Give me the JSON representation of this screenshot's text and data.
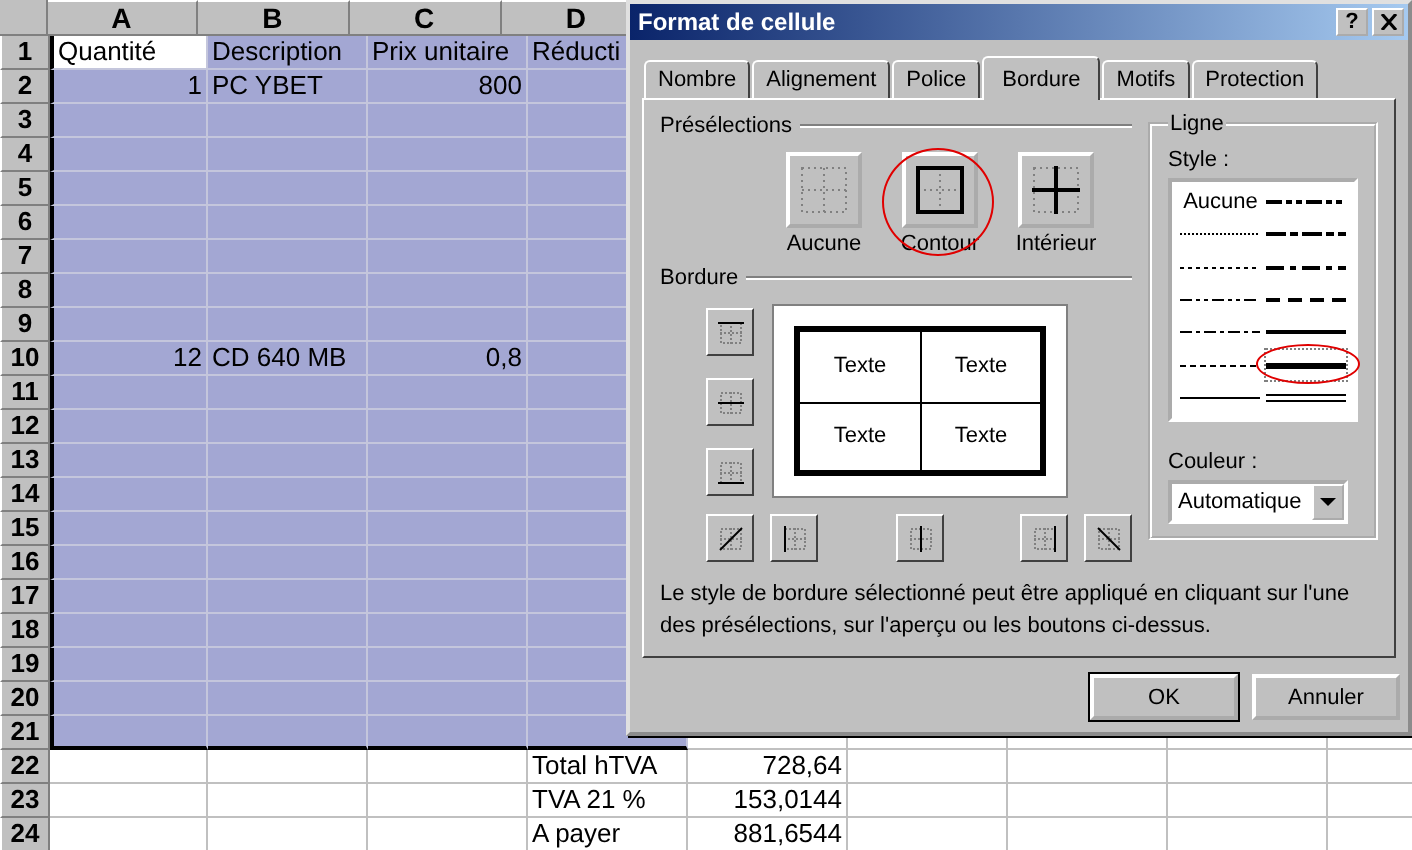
{
  "spreadsheet": {
    "column_headers": [
      "A",
      "B",
      "C",
      "D"
    ],
    "rows": [
      {
        "header": "1",
        "selected": true,
        "cells": [
          {
            "text": "Quantité",
            "active": true
          },
          {
            "text": "Description"
          },
          {
            "text": "Prix unitaire"
          },
          {
            "text": "Réducti"
          }
        ]
      },
      {
        "header": "2",
        "selected": true,
        "cells": [
          {
            "text": "1",
            "kind": "number"
          },
          {
            "text": "PC YBET"
          },
          {
            "text": "800",
            "kind": "number"
          }
        ]
      },
      {
        "header": "3",
        "selected": true
      },
      {
        "header": "4",
        "selected": true
      },
      {
        "header": "5",
        "selected": true
      },
      {
        "header": "6",
        "selected": true
      },
      {
        "header": "7",
        "selected": true
      },
      {
        "header": "8",
        "selected": true
      },
      {
        "header": "9",
        "selected": true
      },
      {
        "header": "10",
        "selected": true,
        "cells": [
          {
            "text": "12",
            "kind": "number"
          },
          {
            "text": "CD 640 MB"
          },
          {
            "text": "0,8",
            "kind": "number"
          }
        ]
      },
      {
        "header": "11",
        "selected": true
      },
      {
        "header": "12",
        "selected": true
      },
      {
        "header": "13",
        "selected": true
      },
      {
        "header": "14",
        "selected": true
      },
      {
        "header": "15",
        "selected": true
      },
      {
        "header": "16",
        "selected": true
      },
      {
        "header": "17",
        "selected": true
      },
      {
        "header": "18",
        "selected": true
      },
      {
        "header": "19",
        "selected": true
      },
      {
        "header": "20",
        "selected": true
      },
      {
        "header": "21",
        "selected": true
      },
      {
        "header": "22",
        "selected": false,
        "cells": [
          {},
          {},
          {},
          {
            "text": "Total hTVA"
          },
          {
            "text": "728,64",
            "kind": "number"
          }
        ]
      },
      {
        "header": "23",
        "selected": false,
        "cells": [
          {},
          {},
          {},
          {
            "text": "TVA 21 %"
          },
          {
            "text": "153,0144",
            "kind": "number"
          }
        ]
      },
      {
        "header": "24",
        "selected": false,
        "cells": [
          {},
          {},
          {},
          {
            "text": "A payer"
          },
          {
            "text": "881,6544",
            "kind": "number"
          }
        ]
      }
    ]
  },
  "dialog": {
    "title": "Format de cellule",
    "help_button": "?",
    "tabs": [
      {
        "label": "Nombre",
        "selected": false
      },
      {
        "label": "Alignement",
        "selected": false
      },
      {
        "label": "Police",
        "selected": false
      },
      {
        "label": "Bordure",
        "selected": true
      },
      {
        "label": "Motifs",
        "selected": false
      },
      {
        "label": "Protection",
        "selected": false
      }
    ],
    "presets": {
      "title": "Présélections",
      "items": [
        {
          "label": "Aucune",
          "kind": "none",
          "circled": false
        },
        {
          "label": "Contour",
          "kind": "outline",
          "circled": true
        },
        {
          "label": "Intérieur",
          "kind": "inside",
          "circled": false
        }
      ]
    },
    "border": {
      "title": "Bordure",
      "preview_cells": [
        "Texte",
        "Texte",
        "Texte",
        "Texte"
      ]
    },
    "line": {
      "title": "Ligne",
      "style_label": "Style :",
      "styles": [
        {
          "kind": "none",
          "label": "Aucune",
          "selected": false,
          "circled": false
        },
        {
          "kind": "hair",
          "selected": false,
          "circled": false
        },
        {
          "kind": "dotted",
          "selected": false,
          "circled": false
        },
        {
          "kind": "dashdotdot",
          "selected": false,
          "circled": false
        },
        {
          "kind": "dashdot",
          "selected": false,
          "circled": false
        },
        {
          "kind": "dashed",
          "selected": false,
          "circled": false
        },
        {
          "kind": "thin",
          "selected": false,
          "circled": false
        },
        {
          "kind": "medium-dashdotdot",
          "selected": false,
          "circled": false
        },
        {
          "kind": "slanted-dashdot",
          "selected": false,
          "circled": false
        },
        {
          "kind": "medium-dashdot",
          "selected": false,
          "circled": false
        },
        {
          "kind": "medium-dashed",
          "selected": false,
          "circled": false
        },
        {
          "kind": "medium",
          "selected": false,
          "circled": false
        },
        {
          "kind": "thick",
          "selected": true,
          "circled": true
        },
        {
          "kind": "double",
          "selected": false,
          "circled": false
        }
      ],
      "color_label": "Couleur :",
      "color_value": "Automatique"
    },
    "hint": "Le style de bordure sélectionné peut être appliqué en cliquant sur l'une des présélections, sur l'aperçu ou les boutons ci-dessus.",
    "buttons": [
      {
        "label": "OK",
        "default": true
      },
      {
        "label": "Annuler",
        "default": false
      }
    ]
  }
}
